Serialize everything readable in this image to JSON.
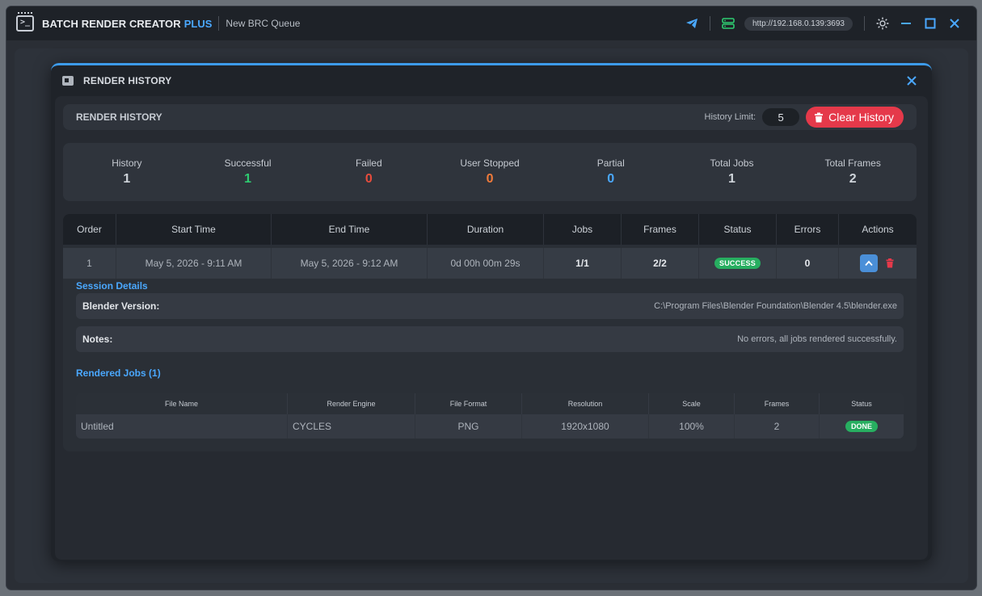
{
  "app": {
    "name": "BATCH RENDER CREATOR",
    "name_suffix": "PLUS",
    "queue_name": "New BRC Queue",
    "server_url": "http://192.168.0.139:3693",
    "accent_color": "#3d9be9"
  },
  "modal": {
    "title": "RENDER HISTORY",
    "section_title": "RENDER HISTORY",
    "history_limit_label": "History Limit:",
    "history_limit_value": "5",
    "clear_button_label": "Clear History"
  },
  "stats": [
    {
      "label": "History",
      "value": "1",
      "color": "#cfd4da"
    },
    {
      "label": "Successful",
      "value": "1",
      "color": "#2ecc71"
    },
    {
      "label": "Failed",
      "value": "0",
      "color": "#e74c3c"
    },
    {
      "label": "User Stopped",
      "value": "0",
      "color": "#f07a3a"
    },
    {
      "label": "Partial",
      "value": "0",
      "color": "#4aa8ff"
    },
    {
      "label": "Total Jobs",
      "value": "1",
      "color": "#cfd4da"
    },
    {
      "label": "Total Frames",
      "value": "2",
      "color": "#cfd4da"
    }
  ],
  "table": {
    "columns": [
      "Order",
      "Start Time",
      "End Time",
      "Duration",
      "Jobs",
      "Frames",
      "Status",
      "Errors",
      "Actions"
    ],
    "row": {
      "order": "1",
      "start_time": "May 5, 2026 - 9:11 AM",
      "end_time": "May 5, 2026 - 9:12 AM",
      "duration": "0d 00h 00m 29s",
      "jobs": "1/1",
      "frames": "2/2",
      "status": "SUCCESS",
      "errors": "0"
    }
  },
  "session": {
    "title": "Session Details",
    "blender_label": "Blender Version:",
    "blender_value": "C:\\Program Files\\Blender Foundation\\Blender 4.5\\blender.exe",
    "notes_label": "Notes:",
    "notes_value": "No errors, all jobs rendered successfully.",
    "jobs_title": "Rendered Jobs (1)"
  },
  "jobs": {
    "columns": [
      "File Name",
      "Render Engine",
      "File Format",
      "Resolution",
      "Scale",
      "Frames",
      "Status"
    ],
    "row": {
      "file_name": "Untitled",
      "engine": "CYCLES",
      "format": "PNG",
      "resolution": "1920x1080",
      "scale": "100%",
      "frames": "2",
      "status": "DONE"
    }
  },
  "icons": {
    "app": "terminal-window-icon",
    "telegram": "send-icon",
    "server": "server-icon",
    "theme": "sun-icon",
    "minimize": "minimize-icon",
    "maximize": "maximize-icon",
    "close": "close-icon",
    "history": "history-folder-icon",
    "trash": "trash-icon",
    "collapse": "chevron-up-icon"
  }
}
